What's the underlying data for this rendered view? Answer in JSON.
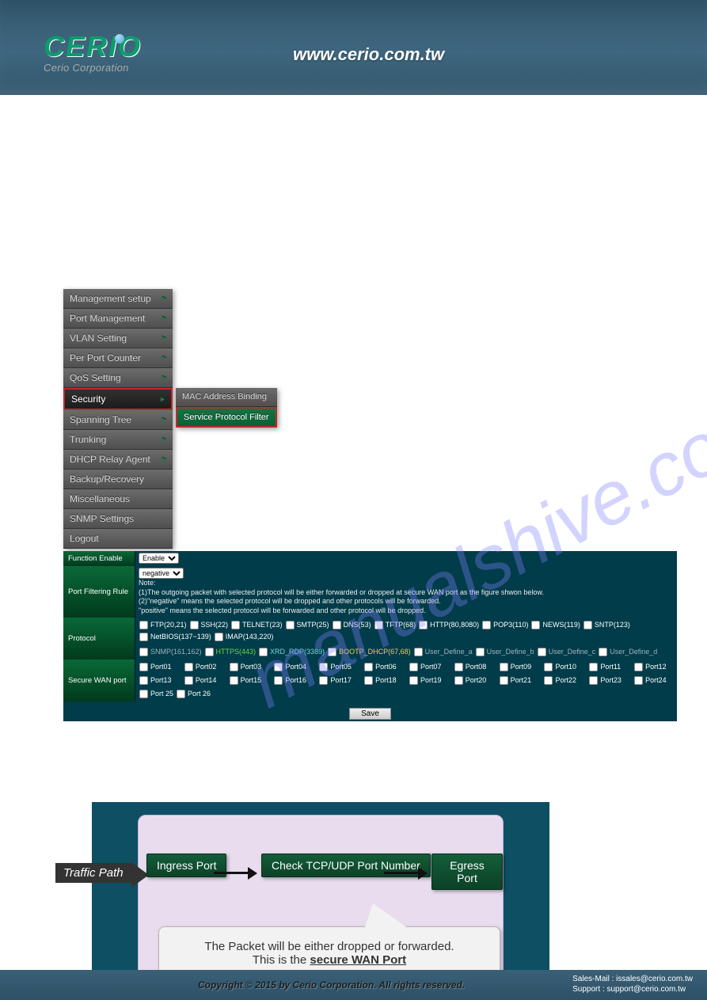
{
  "header": {
    "logo": "CERIO",
    "logo_sub": "Cerio Corporation",
    "url": "www.cerio.com.tw"
  },
  "watermark": "manualshive.com",
  "sidebar": {
    "items": [
      "Management setup",
      "Port Management",
      "VLAN Setting",
      "Per Port Counter",
      "QoS Setting",
      "Security",
      "Spanning Tree",
      "Trunking",
      "DHCP Relay Agent",
      "Backup/Recovery",
      "Miscellaneous",
      "SNMP Settings",
      "Logout"
    ],
    "active_index": 5
  },
  "submenu": {
    "items": [
      "MAC Address Binding",
      "Service Protocol Filter"
    ],
    "active_index": 1
  },
  "panel": {
    "rows": {
      "function_enable": {
        "label": "Function Enable",
        "value": "Enable"
      },
      "port_filtering": {
        "label": "Port Filtering Rule",
        "value": "negative",
        "note_title": "Note:",
        "note1": "(1)The outgoing packet with selected protocol will be either forwarded or dropped at secure WAN port as the figure shwon below.",
        "note2": "(2)\"negative\" means the selected protocol will be dropped and other protocols will be forwarded.",
        "note3": "   \"positive\" means the selected protocol will be forwarded and other protocol will be dropped."
      },
      "protocol": {
        "label": "Protocol",
        "row1": [
          "FTP(20,21)",
          "SSH(22)",
          "TELNET(23)",
          "SMTP(25)",
          "DNS(53)",
          "TFTP(68)",
          "HTTP(80,8080)",
          "POP3(110)",
          "NEWS(119)",
          "SNTP(123)",
          "NetBIOS(137~139)",
          "IMAP(143,220)"
        ],
        "row2": [
          "SNMP(161,162)",
          "HTTPS(443)",
          "XRD_RDP(3389)",
          "BOOTP_DHCP(67,68)",
          "User_Define_a",
          "User_Define_b",
          "User_Define_c",
          "User_Define_d"
        ]
      },
      "secure_wan": {
        "label": "Secure WAN port",
        "ports24": [
          "Port01",
          "Port02",
          "Port03",
          "Port04",
          "Port05",
          "Port06",
          "Port07",
          "Port08",
          "Port09",
          "Port10",
          "Port11",
          "Port12",
          "Port13",
          "Port14",
          "Port15",
          "Port16",
          "Port17",
          "Port18",
          "Port19",
          "Port20",
          "Port21",
          "Port22",
          "Port23",
          "Port24"
        ],
        "ports_extra": [
          "Port 25",
          "Port 26"
        ]
      }
    },
    "save": "Save"
  },
  "diagram": {
    "traffic_path": "Traffic Path",
    "box1": "Ingress Port",
    "box2": "Check TCP/UDP Port Number",
    "box3": "Egress Port",
    "callout_line1": "The Packet will be either dropped or forwarded.",
    "callout_line2a": "This is the ",
    "callout_line2b": "secure WAN Port"
  },
  "footer": {
    "copyright": "Copyright © 2015 by Cerio Corporation. All rights reserved.",
    "sales": "Sales-Mail : issales@cerio.com.tw",
    "support": "Support : support@cerio.com.tw"
  }
}
